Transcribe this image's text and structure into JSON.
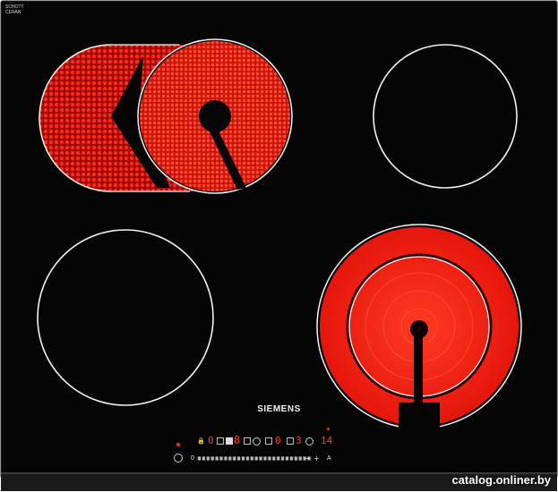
{
  "product": {
    "brand": "SIEMENS",
    "glass_brand_line1": "SCHOTT",
    "glass_brand_line2": "CERAN"
  },
  "control_panel": {
    "display_zone_1": "0",
    "display_zone_2": "8",
    "display_zone_3": "0",
    "display_zone_4": "3",
    "timer_display": "14",
    "slider_min_label": "0",
    "slider_max_label": "A",
    "minus_label": "−",
    "plus_label": "+"
  },
  "watermark": "catalog.onliner.by",
  "colors": {
    "glass": "#050505",
    "heating_red": "#ff2416",
    "ring_white": "#f2f2f2",
    "display_red": "#ff3b2a"
  }
}
